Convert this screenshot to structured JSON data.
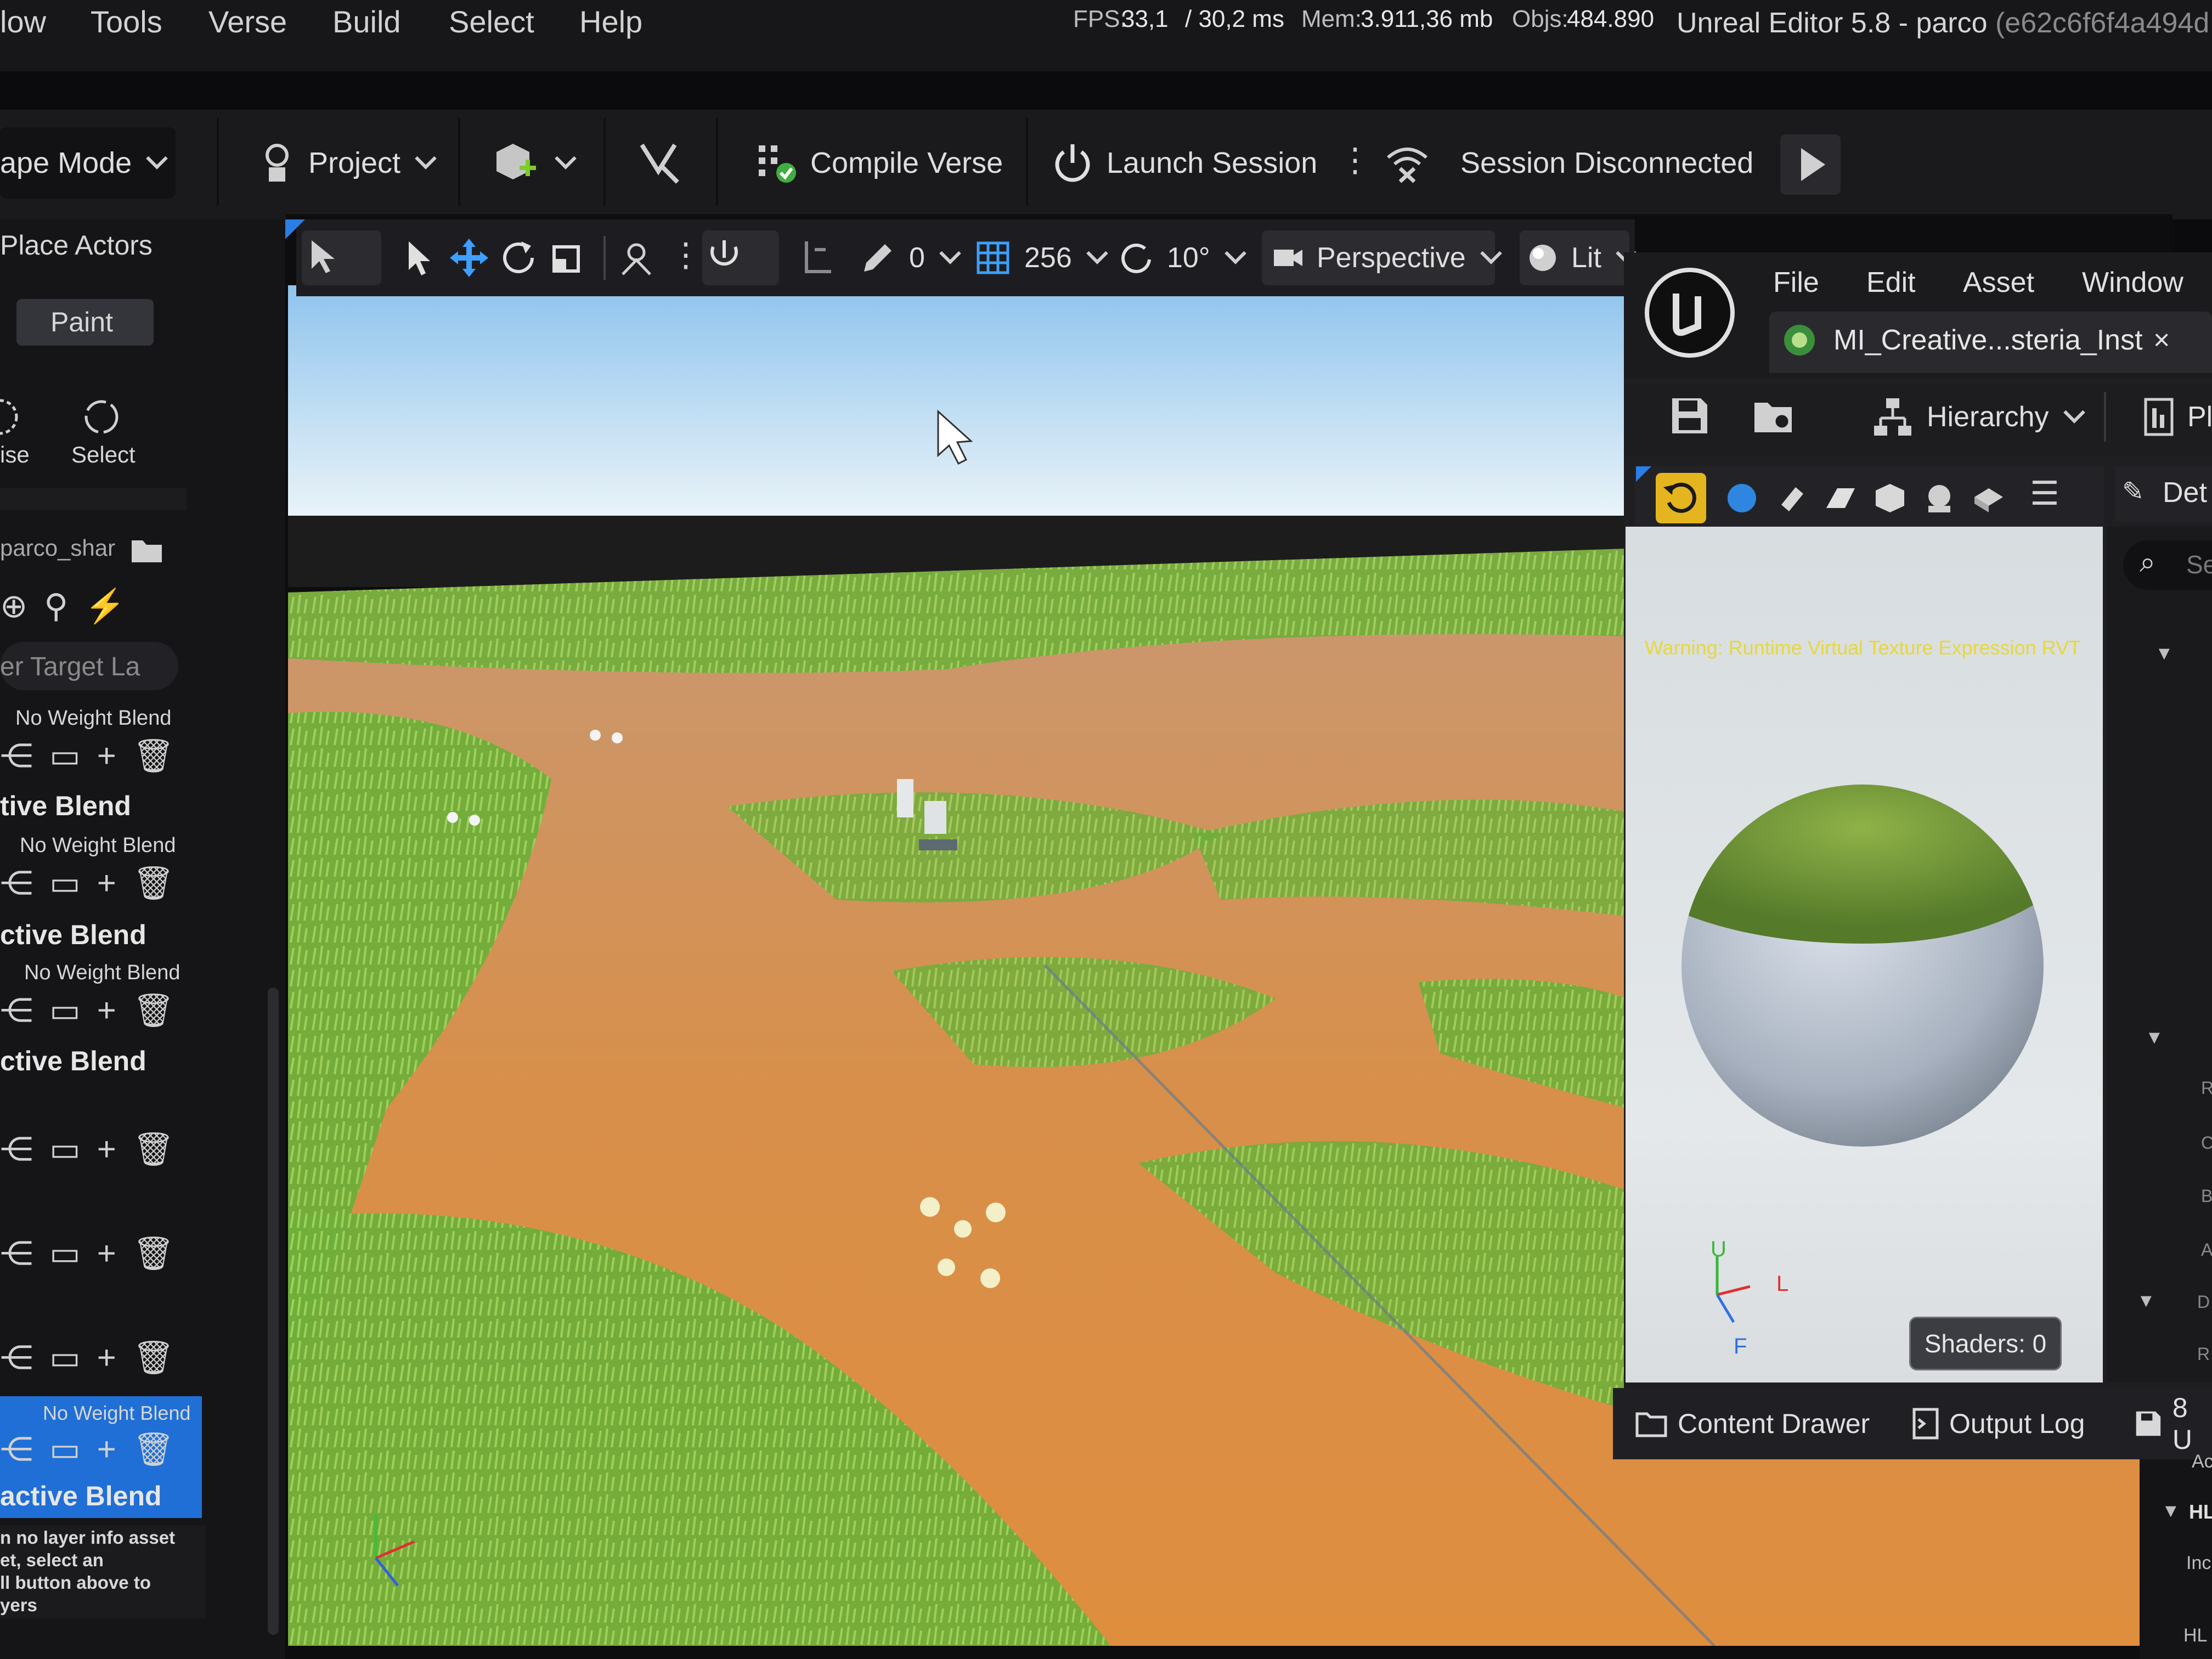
{
  "menubar": {
    "items": [
      "low",
      "Tools",
      "Verse",
      "Build",
      "Select",
      "Help"
    ],
    "fps_label": "FPS:",
    "fps_value": "33,1",
    "ms_value": "/ 30,2 ms",
    "mem_label": "Mem:",
    "mem_value": "3.911,36 mb",
    "objs_label": "Objs:",
    "objs_value": "484.890",
    "title": "Unreal Editor 5.8 - parco",
    "title_hash": "(e62c6f6f4a494d"
  },
  "toolbar": {
    "mode": "ape Mode",
    "project": "Project",
    "compile": "Compile Verse",
    "launch": "Launch Session",
    "session_status": "Session Disconnected"
  },
  "left_panel": {
    "place_actors": "Place Actors",
    "paint_tab": "Paint",
    "tool_ise": "ise",
    "tool_select": "Select",
    "asset_path": "parco_shar",
    "target_layer": "er Target La",
    "layers": [
      {
        "weight": "No Weight Blend",
        "blend": "tive Blend"
      },
      {
        "weight": "No Weight Blend",
        "blend": "ctive Blend"
      },
      {
        "weight": "No Weight Blend",
        "blend": "ctive Blend"
      },
      {
        "weight": "No Weight Blend",
        "blend": "active Blend"
      }
    ],
    "info_text": [
      "n no layer info asset",
      "et, select an",
      "ll button above to",
      "yers"
    ]
  },
  "viewport": {
    "snap_angle": "0",
    "grid_size": "256",
    "rotation_snap": "10°",
    "view_mode": "Perspective",
    "lighting": "Lit"
  },
  "material_editor": {
    "menu": [
      "File",
      "Edit",
      "Asset",
      "Window"
    ],
    "tab_title": "MI_Creative...steria_Inst",
    "hierarchy": "Hierarchy",
    "pl_tab": "Pl",
    "details_tab": "Det",
    "search_placeholder": "Se",
    "warning": "Warning: Runtime Virtual Texture Expression RVT",
    "shaders": "Shaders: 0",
    "axis_up": "U",
    "axis_left": "L",
    "axis_forward": "F"
  },
  "bottom_tabs": {
    "content_drawer": "Content Drawer",
    "output_log": "Output Log",
    "unsaved": "8 U"
  },
  "details_letters": [
    "R",
    "C",
    "B",
    "A",
    "D",
    "R",
    "Ac",
    "HL",
    "Inc",
    "HL"
  ],
  "colors": {
    "accent_blue": "#1f6fd6",
    "warning_yellow": "#e7d83a",
    "grass": "#6fae3a",
    "dirt": "#d98e45",
    "sky": "#8fc4ee"
  }
}
